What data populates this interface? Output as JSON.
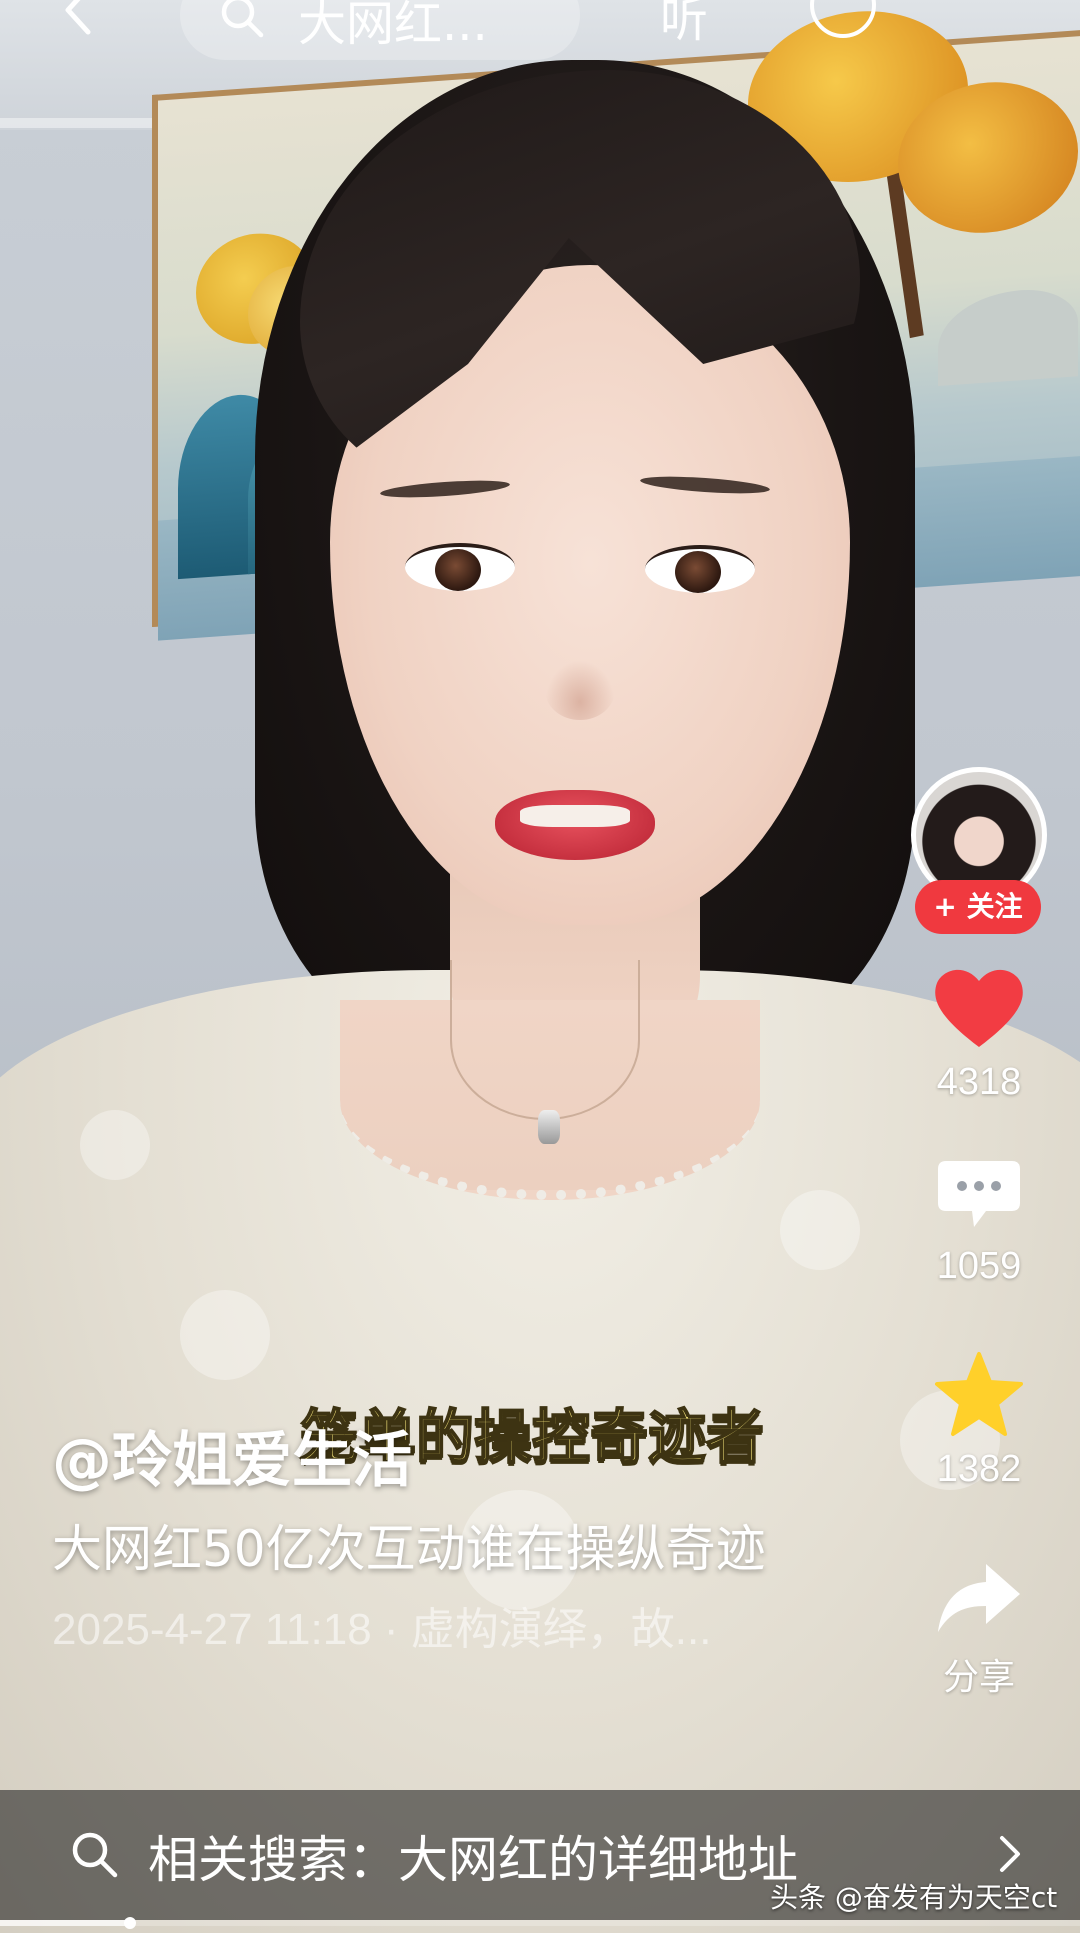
{
  "top_bar": {
    "search_text": "大网红...",
    "listen_label": "听"
  },
  "creator": {
    "follow_label": "+ 关注"
  },
  "actions": {
    "likes": "4318",
    "comments": "1059",
    "favorites": "1382",
    "share_label": "分享"
  },
  "video": {
    "subtitle": "笼单的操控奇迹者",
    "progress": 0.12
  },
  "caption": {
    "author": "@玲姐爱生活",
    "title": "大网红50亿次互动谁在操纵奇迹",
    "meta": "2025-4-27 11:18 · 虚构演绎，故..."
  },
  "related_search": {
    "text": "相关搜索：大网红的详细地址"
  },
  "watermark": "头条 @奋发有为天空ct",
  "colors": {
    "like_red": "#f23c43",
    "follow_red": "#f0393f",
    "star_yellow": "#ffd02a"
  },
  "icons": [
    "back-icon",
    "search-icon",
    "more-icon",
    "heart-icon",
    "comment-icon",
    "star-icon",
    "share-icon",
    "chevron-right-icon"
  ]
}
